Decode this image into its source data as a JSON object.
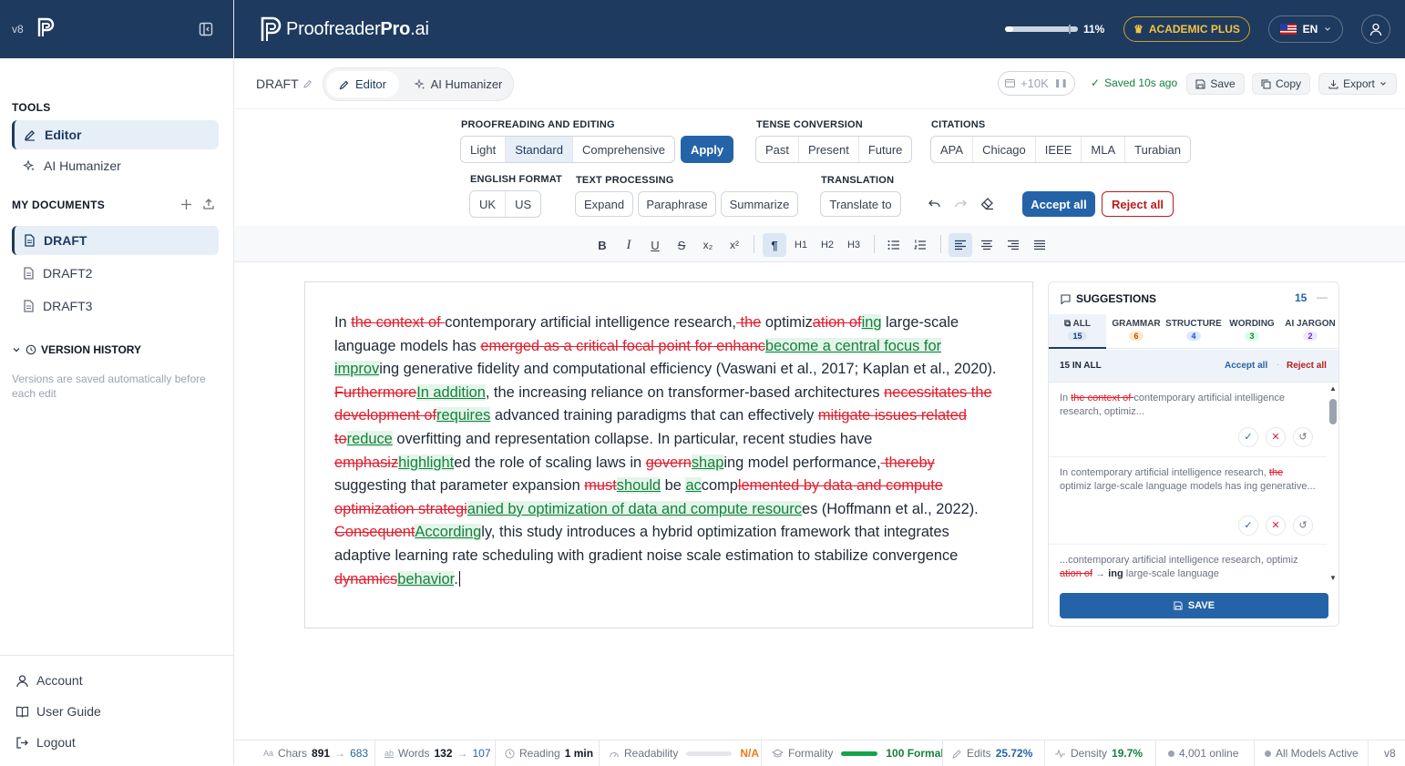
{
  "sidebar": {
    "version": "v8",
    "tools_title": "TOOLS",
    "tools": [
      {
        "label": "Editor"
      },
      {
        "label": "AI Humanizer"
      }
    ],
    "docs_title": "MY DOCUMENTS",
    "docs": [
      {
        "label": "DRAFT"
      },
      {
        "label": "DRAFT2"
      },
      {
        "label": "DRAFT3"
      }
    ],
    "history_title": "VERSION HISTORY",
    "history_note": "Versions are saved automatically before each edit",
    "footer": [
      {
        "label": "Account"
      },
      {
        "label": "User Guide"
      },
      {
        "label": "Logout"
      }
    ]
  },
  "topbar": {
    "brand_a": "Proofreader",
    "brand_b": "Pro",
    "brand_c": ".ai",
    "usage_percent": "11%",
    "usage_fraction": 0.11,
    "plan": "ACADEMIC PLUS",
    "lang": "EN"
  },
  "doc": {
    "name": "DRAFT",
    "tab_editor": "Editor",
    "tab_humanizer": "AI Humanizer",
    "tokens": "+10K",
    "saved": "Saved 10s ago",
    "save": "Save",
    "copy": "Copy",
    "export": "Export"
  },
  "controls": {
    "proof_label": "PROOFREADING AND EDITING",
    "proof_opts": [
      "Light",
      "Standard",
      "Comprehensive"
    ],
    "apply": "Apply",
    "tense_label": "TENSE CONVERSION",
    "tense_opts": [
      "Past",
      "Present",
      "Future"
    ],
    "cite_label": "CITATIONS",
    "cite_opts": [
      "APA",
      "Chicago",
      "IEEE",
      "MLA",
      "Turabian"
    ],
    "eng_label": "ENGLISH FORMAT",
    "eng_opts": [
      "UK",
      "US"
    ],
    "text_label": "TEXT PROCESSING",
    "text_opts": [
      "Expand",
      "Paraphrase",
      "Summarize"
    ],
    "trans_label": "TRANSLATION",
    "translate": "Translate to",
    "accept_all": "Accept all",
    "reject_all": "Reject all"
  },
  "format": {
    "bold": "B",
    "italic": "I",
    "underline": "U",
    "strike": "S",
    "sub": "x₂",
    "sup": "x²",
    "para": "¶",
    "h1": "H1",
    "h2": "H2",
    "h3": "H3"
  },
  "editor": {
    "segments": [
      {
        "t": "n",
        "v": "In "
      },
      {
        "t": "d",
        "v": "the context of "
      },
      {
        "t": "n",
        "v": "contemporary artificial intelligence research,"
      },
      {
        "t": "d",
        "v": " the"
      },
      {
        "t": "n",
        "v": " optimiz"
      },
      {
        "t": "d",
        "v": "ation of"
      },
      {
        "t": "i",
        "v": "ing"
      },
      {
        "t": "n",
        "v": " large-scale language models has "
      },
      {
        "t": "d",
        "v": "emerged as a critical focal point for enhanc"
      },
      {
        "t": "i",
        "v": "become a central focus for improv"
      },
      {
        "t": "n",
        "v": "ing generative fidelity and computational efficiency (Vaswani et al., 2017; Kaplan et al., 2020). "
      },
      {
        "t": "d",
        "v": "Furthermore"
      },
      {
        "t": "i",
        "v": "In addition"
      },
      {
        "t": "n",
        "v": ", the increasing reliance on transformer-based architectures "
      },
      {
        "t": "d",
        "v": "necessitates the development of"
      },
      {
        "t": "i",
        "v": "requires"
      },
      {
        "t": "n",
        "v": " advanced training paradigms that can effectively "
      },
      {
        "t": "d",
        "v": "mitigate issues related to"
      },
      {
        "t": "i",
        "v": "reduce"
      },
      {
        "t": "n",
        "v": " overfitting and representation collapse. In particular, recent studies have "
      },
      {
        "t": "d",
        "v": "emphasiz"
      },
      {
        "t": "i",
        "v": "highlight"
      },
      {
        "t": "n",
        "v": "ed the role of scaling laws in "
      },
      {
        "t": "d",
        "v": "govern"
      },
      {
        "t": "i",
        "v": "shap"
      },
      {
        "t": "n",
        "v": "ing model performance,"
      },
      {
        "t": "d",
        "v": " thereby"
      },
      {
        "t": "n",
        "v": " suggesting that parameter expansion "
      },
      {
        "t": "d",
        "v": "must"
      },
      {
        "t": "i",
        "v": "should"
      },
      {
        "t": "n",
        "v": " be "
      },
      {
        "t": "i",
        "v": "ac"
      },
      {
        "t": "n",
        "v": "comp"
      },
      {
        "t": "d",
        "v": "lemented by data and compute optimization strategi"
      },
      {
        "t": "i",
        "v": "anied by optimization of data and compute resourc"
      },
      {
        "t": "n",
        "v": "es (Hoffmann et al., 2022). "
      },
      {
        "t": "d",
        "v": "Consequent"
      },
      {
        "t": "i",
        "v": "According"
      },
      {
        "t": "n",
        "v": "ly, this study introduces a hybrid optimization framework that integrates adaptive learning rate scheduling with gradient noise scale estimation to stabilize convergence "
      },
      {
        "t": "d",
        "v": "dynamics"
      },
      {
        "t": "i",
        "v": "behavior"
      },
      {
        "t": "n",
        "v": "."
      }
    ]
  },
  "suggestions": {
    "title": "SUGGESTIONS",
    "count": "15",
    "tabs": [
      {
        "label": "ALL",
        "count": "15",
        "color": "#dbe7f5",
        "tc": "#1e3a5f"
      },
      {
        "label": "GRAMMAR",
        "count": "6",
        "color": "#fde8c8",
        "tc": "#b45309"
      },
      {
        "label": "STRUCTURE",
        "count": "4",
        "color": "#dbeafe",
        "tc": "#1d4ed8"
      },
      {
        "label": "WORDING",
        "count": "3",
        "color": "#dcfce7",
        "tc": "#15803d"
      },
      {
        "label": "AI JARGON",
        "count": "2",
        "color": "#ede9fe",
        "tc": "#6d28d9"
      }
    ],
    "in_all": "15 IN ALL",
    "accept_all": "Accept all",
    "dot": "·",
    "reject_all": "Reject all",
    "card1": {
      "pre": "In ",
      "del": "the context of ",
      "post": "contemporary artificial intelligence research, optimiz..."
    },
    "card2": {
      "pre": "In contemporary artificial intelligence research, ",
      "del": "the",
      "post": " optimiz large-scale language models has ing generative..."
    },
    "card3": {
      "pre": "...contemporary artificial intelligence research, optimiz ",
      "del": "ation of",
      "arrow": " → ",
      "ins": "ing",
      "post": " large-scale language"
    },
    "save": "SAVE"
  },
  "status": {
    "chars_label": "Chars",
    "chars_from": "891",
    "chars_to": "683",
    "words_label": "Words",
    "words_from": "132",
    "words_to": "107",
    "reading_label": "Reading",
    "reading": "1 min",
    "readability_label": "Readability",
    "readability": "N/A",
    "formality_label": "Formality",
    "formality": "100 Formal",
    "formality_fraction": 1.0,
    "edits_label": "Edits",
    "edits": "25.72%",
    "density_label": "Density",
    "density": "19.7%",
    "online": "4,001 online",
    "models": "All Models Active",
    "version": "v8"
  }
}
